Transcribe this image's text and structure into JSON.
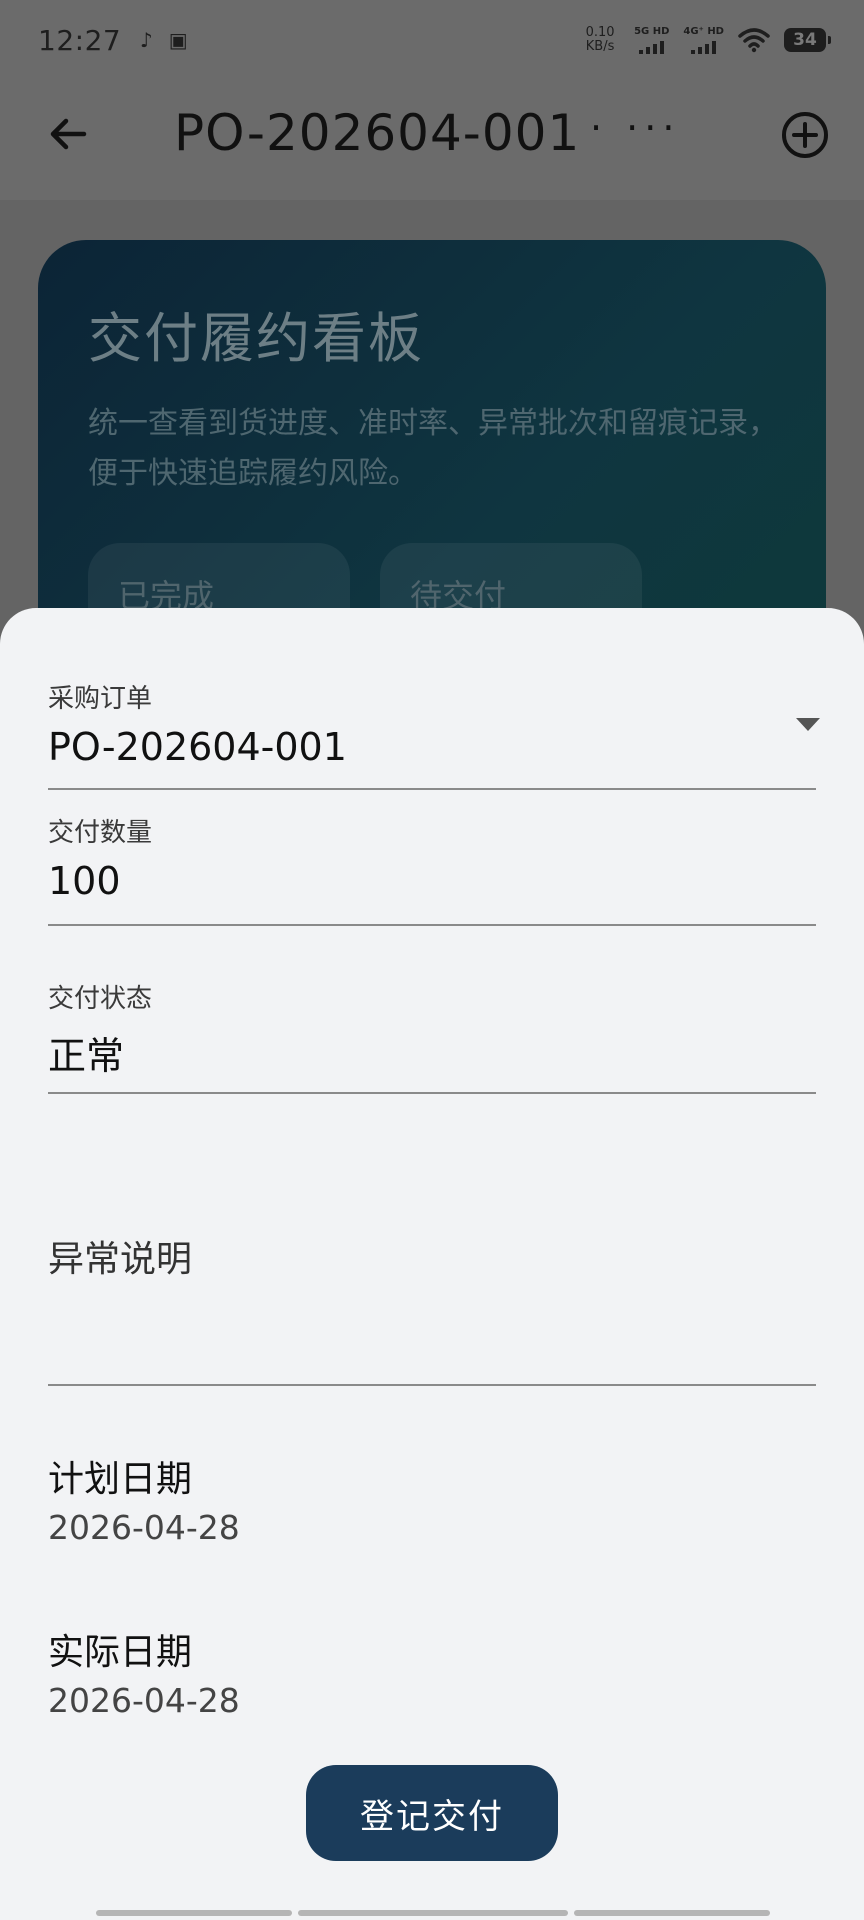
{
  "status_bar": {
    "time": "12:27",
    "app_icons": [
      "tiktok-icon",
      "gallery-icon"
    ],
    "net_speed_value": "0.10",
    "net_speed_unit": "KB/s",
    "signal1_label": "5G HD",
    "signal2_label": "4G⁺ HD",
    "battery": "34"
  },
  "app_bar": {
    "title": "PO-202604-001",
    "more": "· ···",
    "back_icon": "arrow-left-icon",
    "add_icon": "add-circle-icon"
  },
  "hero": {
    "title": "交付履约看板",
    "description": "统一查看到货进度、准时率、异常批次和留痕记录，便于快速追踪履约风险。",
    "chips": [
      {
        "label": "已完成"
      },
      {
        "label": "待交付"
      }
    ]
  },
  "form": {
    "po": {
      "label": "采购订单",
      "value": "PO-202604-001"
    },
    "quantity": {
      "label": "交付数量",
      "value": "100"
    },
    "status": {
      "label": "交付状态",
      "value": "正常"
    },
    "exception": {
      "placeholder": "异常说明"
    },
    "planned_date": {
      "label": "计划日期",
      "value": "2026-04-28"
    },
    "actual_date": {
      "label": "实际日期",
      "value": "2026-04-28"
    },
    "submit_label": "登记交付"
  }
}
